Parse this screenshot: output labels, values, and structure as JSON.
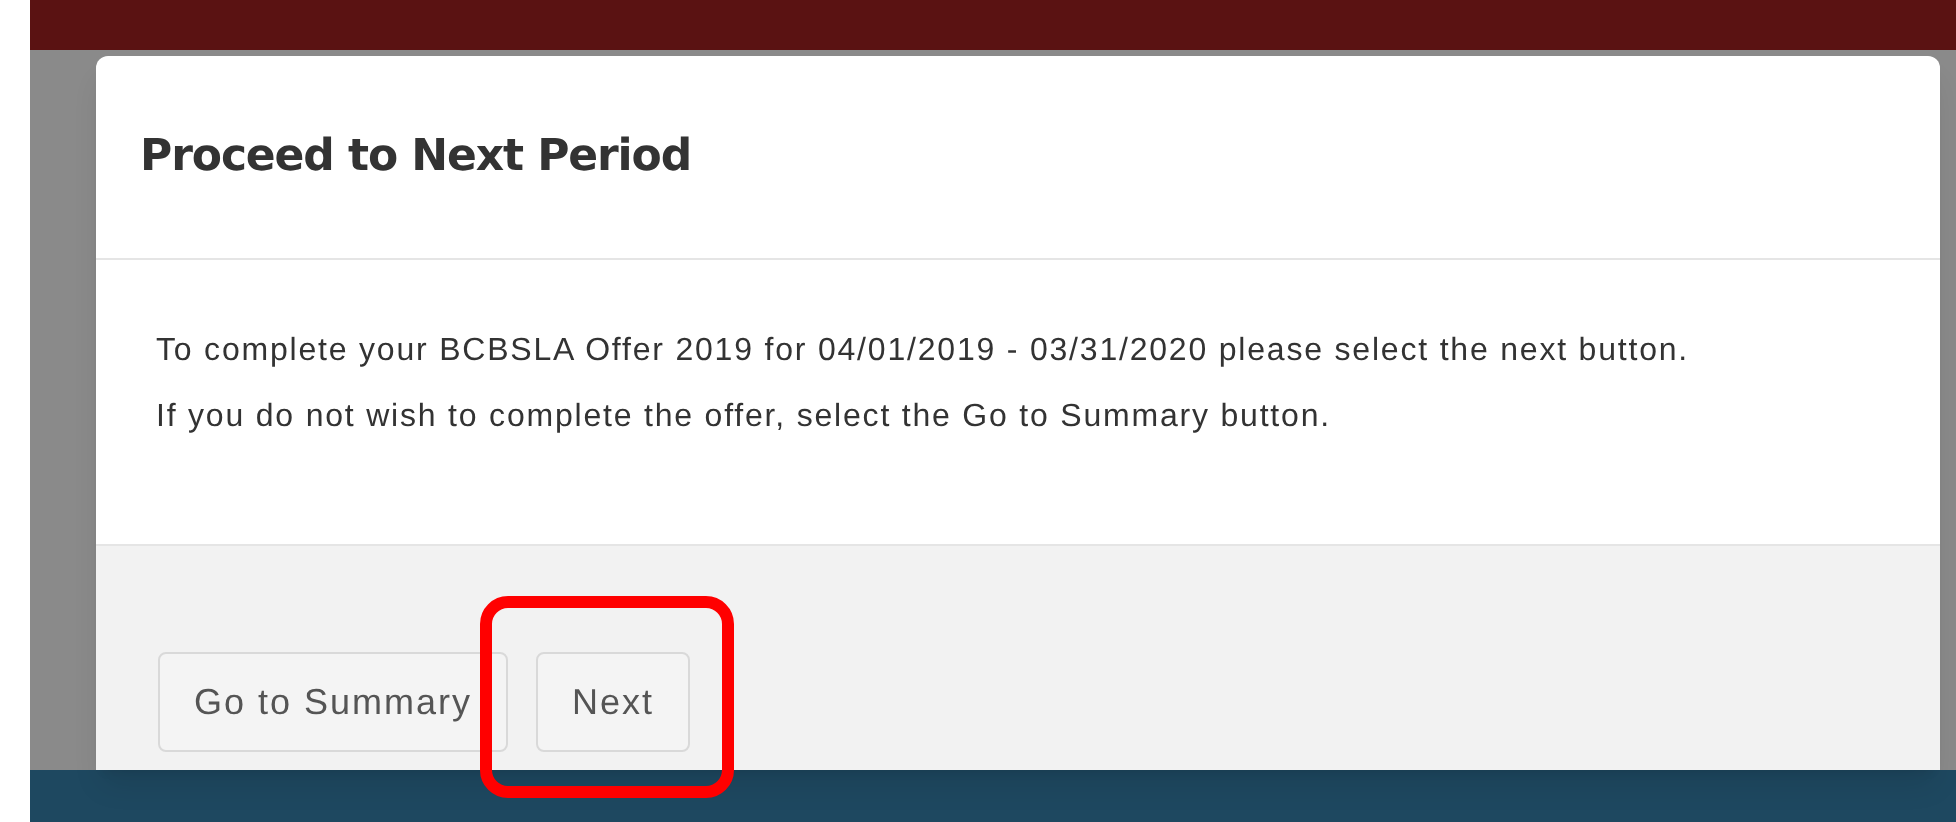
{
  "dialog": {
    "title": "Proceed to Next Period",
    "message_lines": [
      "To complete your BCBSLA Offer 2019 for 04/01/2019 - 03/31/2020 please select the next button.",
      "If you do not wish to complete the offer, select the Go to Summary button."
    ],
    "buttons": [
      {
        "label": "Go to Summary",
        "highlighted": false
      },
      {
        "label": "Next",
        "highlighted": true
      }
    ]
  }
}
